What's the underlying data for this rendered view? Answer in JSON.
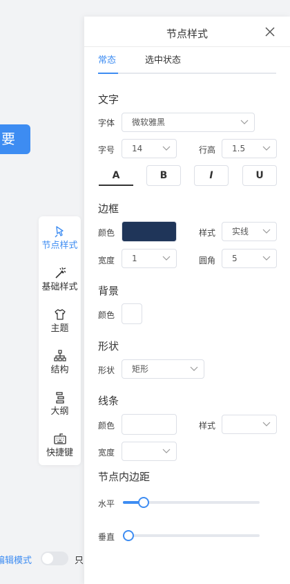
{
  "canvas": {
    "node_label": "要",
    "accent": "#3d8cf2"
  },
  "toolbar": {
    "items": [
      {
        "label": "节点样式",
        "icon": "paint-brush-icon",
        "active": true
      },
      {
        "label": "基础样式",
        "icon": "magic-wand-icon",
        "active": false
      },
      {
        "label": "主题",
        "icon": "shirt-icon",
        "active": false
      },
      {
        "label": "结构",
        "icon": "tree-structure-icon",
        "active": false
      },
      {
        "label": "大纲",
        "icon": "outline-list-icon",
        "active": false
      },
      {
        "label": "快捷键",
        "icon": "keyboard-icon",
        "active": false
      }
    ]
  },
  "bottom_bar": {
    "mode_label": "编辑模式",
    "readonly_label": "只"
  },
  "panel": {
    "title": "节点样式",
    "tabs": [
      {
        "label": "常态",
        "active": true
      },
      {
        "label": "选中状态",
        "active": false
      }
    ],
    "text_section": {
      "title": "文字",
      "font_label": "字体",
      "font_value": "微软雅黑",
      "size_label": "字号",
      "size_value": "14",
      "line_height_label": "行高",
      "line_height_value": "1.5",
      "bold_label": "A",
      "bold2_label": "B",
      "italic_label": "I",
      "underline_label": "U"
    },
    "border_section": {
      "title": "边框",
      "color_label": "颜色",
      "color_value": "#1f3559",
      "style_label": "样式",
      "style_value": "实线",
      "width_label": "宽度",
      "width_value": "1",
      "radius_label": "圆角",
      "radius_value": "5"
    },
    "background_section": {
      "title": "背景",
      "color_label": "颜色",
      "color_value": "#ffffff"
    },
    "shape_section": {
      "title": "形状",
      "shape_label": "形状",
      "shape_value": "矩形"
    },
    "line_section": {
      "title": "线条",
      "color_label": "颜色",
      "style_label": "样式",
      "width_label": "宽度"
    },
    "padding_section": {
      "title": "节点内边距",
      "horizontal_label": "水平",
      "horizontal_fraction": 0.15,
      "vertical_label": "垂直",
      "vertical_fraction": 0.0
    }
  }
}
